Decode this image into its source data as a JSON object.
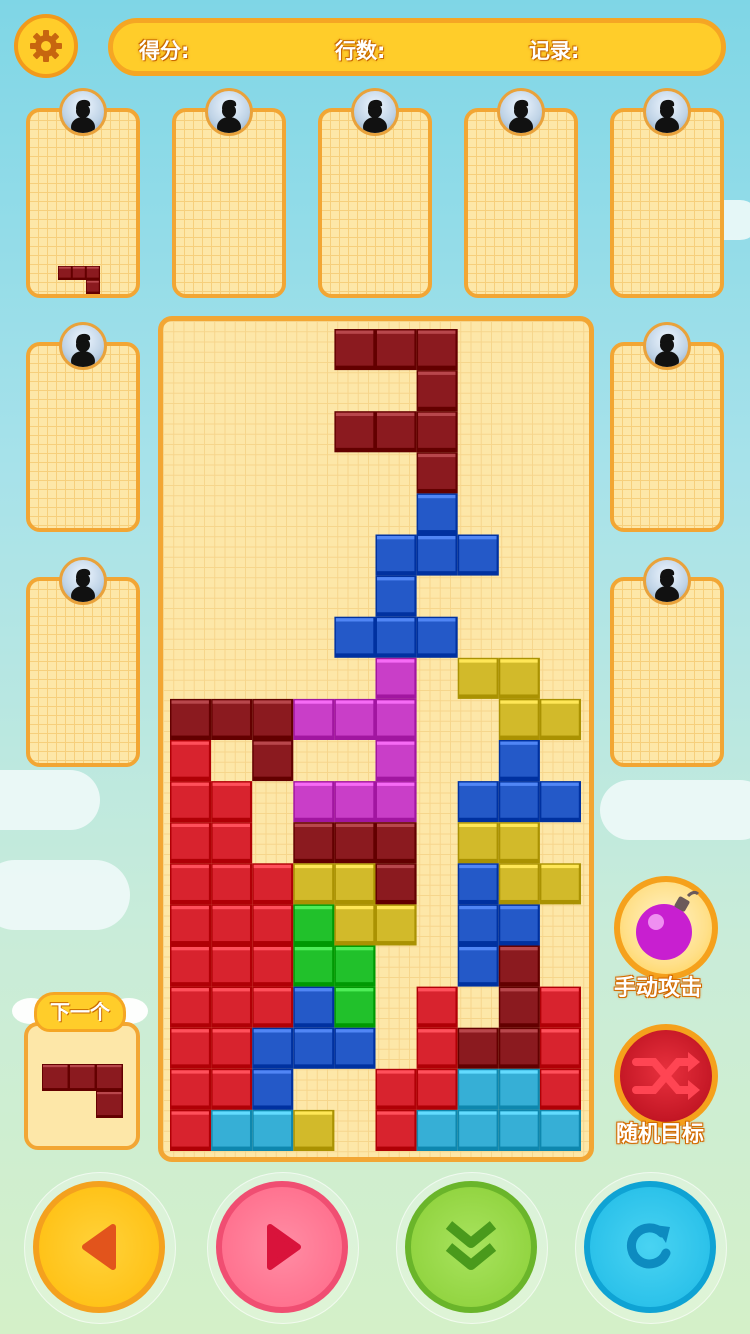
{
  "stats": {
    "score_label": "得分:",
    "lines_label": "行数:",
    "record_label": "记录:"
  },
  "settings_icon": "gear-icon",
  "player_avatar_icon": "player-silhouette-icon",
  "next_piece": {
    "label": "下一个"
  },
  "power_ups": {
    "manual_attack": {
      "label": "手动攻击",
      "icon": "bomb-icon"
    },
    "random_target": {
      "label": "随机目标",
      "icon": "shuffle-icon"
    }
  },
  "controls": {
    "left": {
      "icon": "arrow-left-icon"
    },
    "right": {
      "icon": "arrow-right-icon"
    },
    "drop": {
      "icon": "double-chevron-down-icon"
    },
    "rotate": {
      "icon": "rotate-icon"
    }
  },
  "colors": {
    "D": "#8b1a1f",
    "R": "#d8232e",
    "B": "#2459c8",
    "C": "#36afd6",
    "G": "#21c12b",
    "Y": "#d2ba2a",
    "M": "#c93ec8"
  },
  "board": {
    "cols": 10,
    "rows": 20,
    "grid": [
      "....DDD...",
      "......D...",
      "....DDD...",
      "......D...",
      "......B...",
      ".....BBB..",
      ".....B....",
      "....BBB...",
      ".....M.YY.",
      "DDDMMM..YY",
      "R.D..M..B.",
      "RR.MMM.BBB",
      "RR.DDD.YY.",
      "RRRYYD.BYY",
      "RRRGYY.BB.",
      "RRRGG..BD.",
      "RRRBG.R.DR",
      "RRBBB.RDDR",
      "RRB..RRCCR",
      "RCCY.RCCCC"
    ]
  },
  "opponents": [
    {
      "preview": [
        {
          "c": 1,
          "r": 0
        },
        {
          "c": 2,
          "r": 0
        },
        {
          "c": 3,
          "r": 0
        },
        {
          "c": 3,
          "r": 1
        }
      ]
    },
    {
      "preview": []
    },
    {
      "preview": []
    },
    {
      "preview": []
    },
    {
      "preview": []
    },
    {
      "preview": []
    },
    {
      "preview": []
    },
    {
      "preview": []
    },
    {
      "preview": []
    }
  ],
  "next_cells": [
    {
      "c": 0,
      "r": 0
    },
    {
      "c": 1,
      "r": 0
    },
    {
      "c": 2,
      "r": 0
    },
    {
      "c": 2,
      "r": 1
    }
  ]
}
